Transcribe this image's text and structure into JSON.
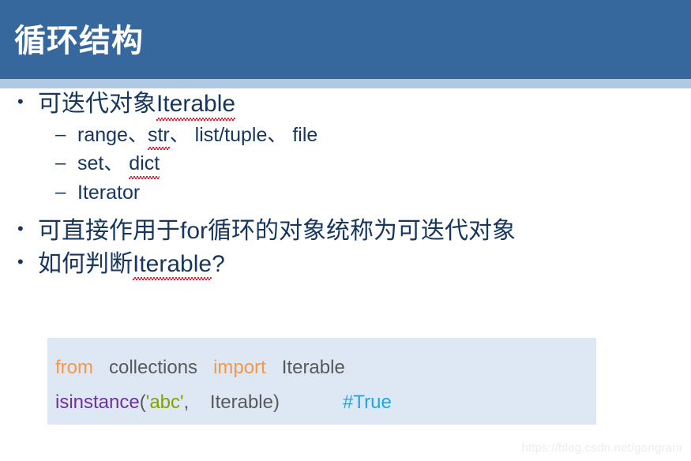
{
  "header": {
    "title": "循环结构",
    "banner_color": "#36689E",
    "stripe_color": "#AFC8E3",
    "title_color": "#FFFFFF"
  },
  "content": {
    "text_color": "#17365D",
    "bullet_glyph": "•",
    "dash_glyph": "–",
    "bullets": [
      {
        "level": 1,
        "parts": [
          {
            "text": "可迭代对象",
            "spell_error": false
          },
          {
            "text": "Iterable",
            "spell_error": true
          }
        ]
      },
      {
        "level": 2,
        "parts": [
          {
            "text": "range、",
            "spell_error": false
          },
          {
            "text": "str",
            "spell_error": true
          },
          {
            "text": "、 list/tuple、 file",
            "spell_error": false
          }
        ]
      },
      {
        "level": 2,
        "parts": [
          {
            "text": "set、 ",
            "spell_error": false
          },
          {
            "text": "dict",
            "spell_error": true
          }
        ]
      },
      {
        "level": 2,
        "parts": [
          {
            "text": "Iterator",
            "spell_error": false
          }
        ]
      },
      {
        "level": 1,
        "parts": [
          {
            "text": "可直接作用于for循环的对象统称为可迭代对象",
            "spell_error": false
          }
        ]
      },
      {
        "level": 1,
        "parts": [
          {
            "text": "如何判断",
            "spell_error": false
          },
          {
            "text": "Iterable",
            "spell_error": true
          },
          {
            "text": "?",
            "spell_error": false
          }
        ]
      }
    ]
  },
  "code_block": {
    "background": "#DEE8F5",
    "lines": [
      {
        "tokens": [
          {
            "text": "from",
            "type": "kw"
          },
          {
            "text": "   collections   ",
            "type": "plain"
          },
          {
            "text": "import",
            "type": "kw"
          },
          {
            "text": "   Iterable",
            "type": "plain"
          }
        ]
      },
      {
        "tokens": [
          {
            "text": "isinstance",
            "type": "fn"
          },
          {
            "text": "(",
            "type": "punct"
          },
          {
            "text": "'abc'",
            "type": "str"
          },
          {
            "text": ",    Iterable)",
            "type": "punct"
          },
          {
            "text": "            ",
            "type": "plain"
          },
          {
            "text": "#True",
            "type": "comment"
          }
        ]
      }
    ],
    "token_colors": {
      "kw": "#F79646",
      "plain": "#595959",
      "fn": "#7030A0",
      "str": "#86A000",
      "punct": "#595959",
      "comment": "#1CA8E8"
    }
  },
  "watermark": {
    "text": "https://blog.csdn.net/gongranr",
    "color": "#EDEDED"
  }
}
